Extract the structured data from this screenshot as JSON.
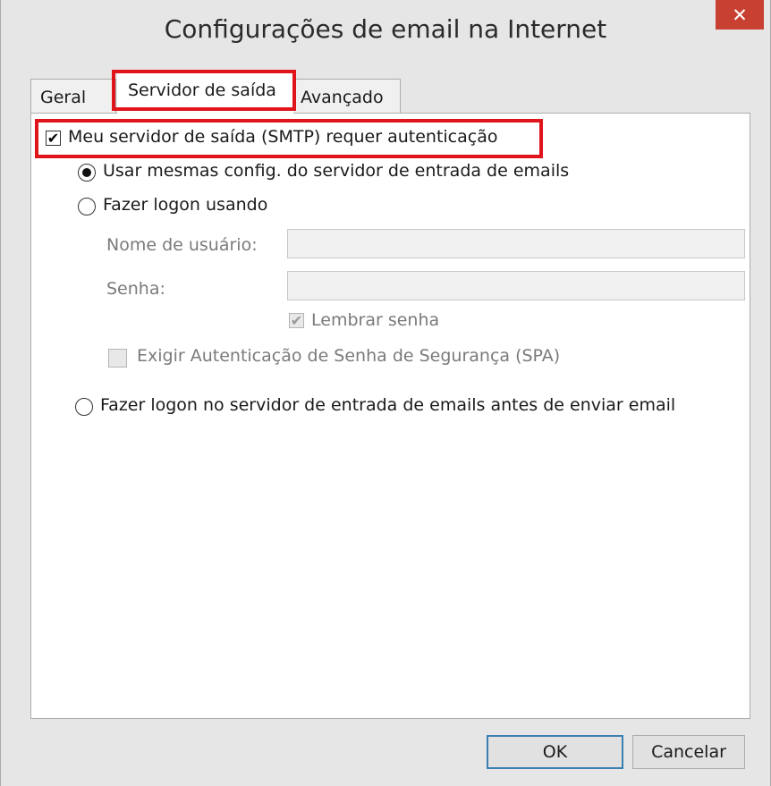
{
  "window": {
    "title": "Configurações de email na Internet",
    "close_glyph": "✕"
  },
  "tabs": [
    {
      "label": "Geral",
      "active": false
    },
    {
      "label": "Servidor de saída",
      "active": true
    },
    {
      "label": "Avançado",
      "active": false
    }
  ],
  "outgoing": {
    "require_auth": {
      "label": "Meu servidor de saída (SMTP) requer autenticação",
      "checked": true,
      "glyph": "✔"
    },
    "use_same": {
      "label": "Usar mesmas config. do servidor de entrada de emails",
      "selected": true
    },
    "logon_using": {
      "label": "Fazer logon usando",
      "selected": false
    },
    "username": {
      "label": "Nome de usuário:",
      "value": ""
    },
    "password": {
      "label": "Senha:",
      "value": ""
    },
    "remember_password": {
      "label": "Lembrar senha",
      "checked": true,
      "glyph": "✔"
    },
    "spa": {
      "label": "Exigir Autenticação de Senha de Segurança (SPA)",
      "checked": false
    },
    "logon_incoming": {
      "label": "Fazer logon no servidor de entrada de emails antes de enviar email",
      "selected": false
    }
  },
  "buttons": {
    "ok": "OK",
    "cancel": "Cancelar"
  },
  "colors": {
    "highlight": "#e0151c",
    "close": "#c84031",
    "ok_border": "#3c7fb1"
  }
}
